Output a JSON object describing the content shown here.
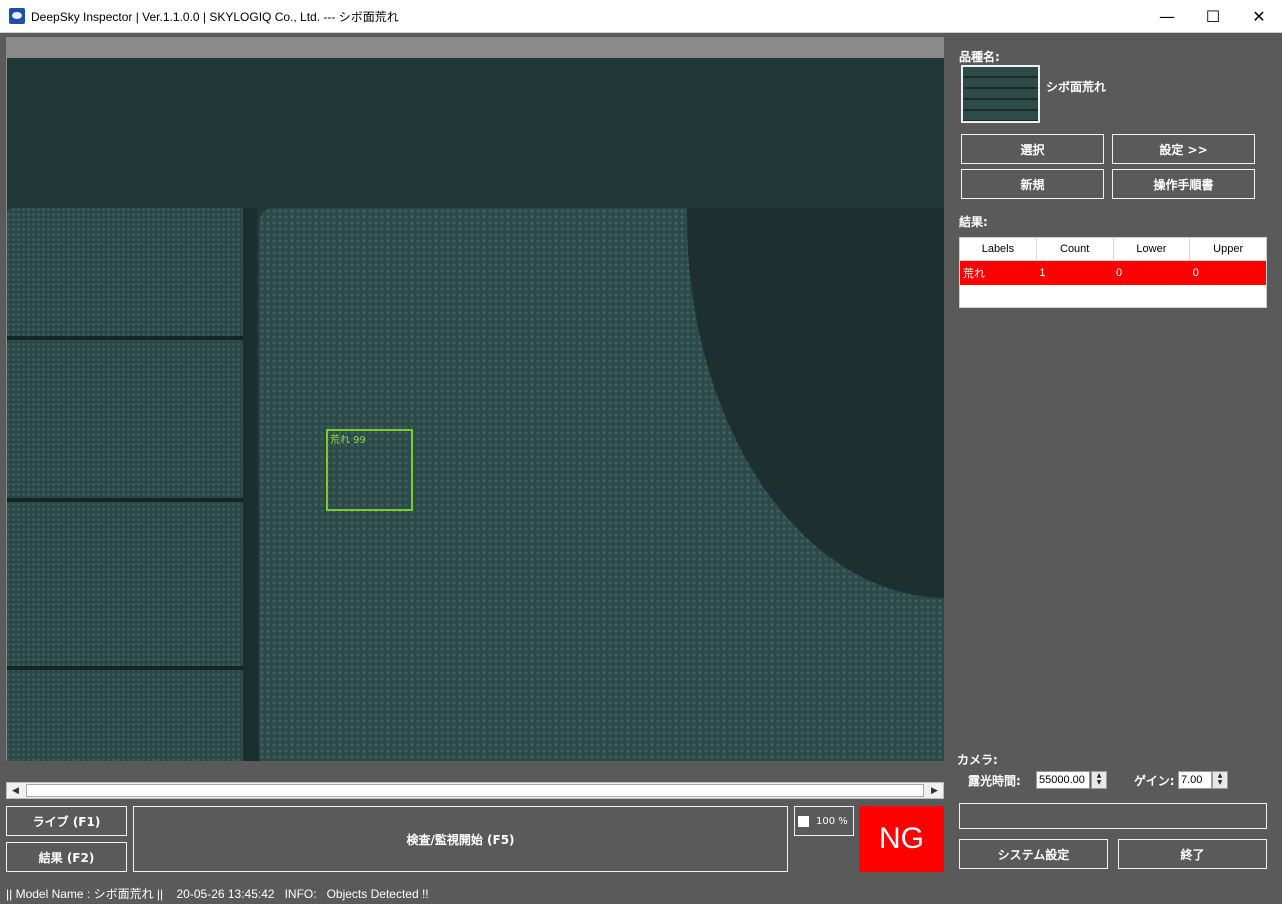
{
  "window": {
    "title": "DeepSky Inspector | Ver.1.1.0.0 | SKYLOGIQ Co., Ltd. --- シボ面荒れ",
    "minimize": "—",
    "maximize": "☐",
    "close": "✕"
  },
  "viewer": {
    "detection_label": "荒れ 99"
  },
  "controls": {
    "live_button": "ライブ (F1)",
    "result_button": "結果 (F2)",
    "inspect_button": "検査/監視開始 (F5)",
    "zoom_label": "100 %",
    "judgement": "NG",
    "judgement_color": "#ff0000"
  },
  "status_bar": {
    "text": "|| Model Name : シボ面荒れ ||    20-05-26 13:45:42   INFO:   Objects Detected !!"
  },
  "product": {
    "label": "品種名:",
    "name": "シボ面荒れ",
    "select_button": "選択",
    "settings_button": "設定 >>",
    "new_button": "新規",
    "manual_button": "操作手順書"
  },
  "results": {
    "label": "結果:",
    "columns": [
      "Labels",
      "Count",
      "Lower",
      "Upper"
    ],
    "rows": [
      {
        "label": "荒れ",
        "count": "1",
        "lower": "0",
        "upper": "0"
      }
    ]
  },
  "camera": {
    "label": "カメラ:",
    "exposure_label": "露光時間:",
    "exposure_value": "55000.00",
    "gain_label": "ゲイン:",
    "gain_value": "7.00"
  },
  "footer_buttons": {
    "system_settings": "システム設定",
    "exit": "終了"
  }
}
